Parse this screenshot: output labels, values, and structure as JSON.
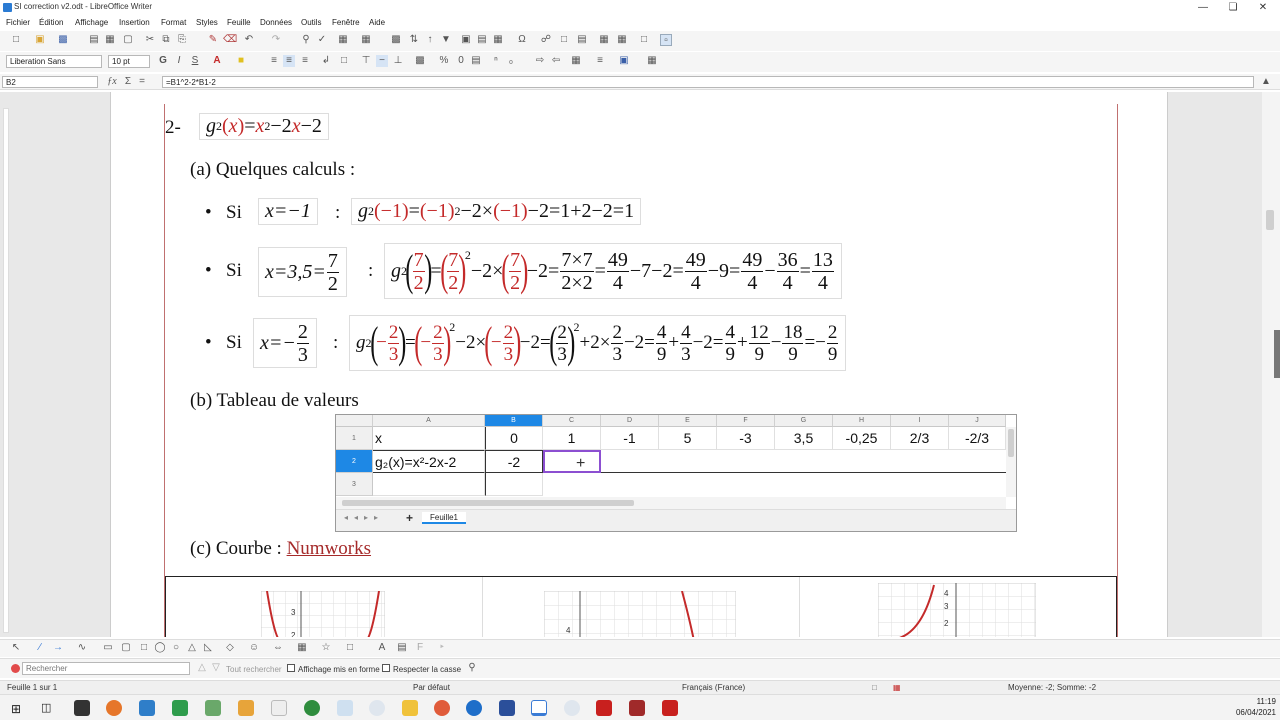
{
  "window": {
    "title": "SI correction v2.odt - LibreOffice Writer"
  },
  "menu": [
    "Fichier",
    "Édition",
    "Affichage",
    "Insertion",
    "Format",
    "Styles",
    "Feuille",
    "Données",
    "Outils",
    "Fenêtre",
    "Aide"
  ],
  "format_bar": {
    "font_name": "Liberation Sans",
    "font_size": "10 pt",
    "bold": "G",
    "italic": "I",
    "underline": "S"
  },
  "formula_bar": {
    "cell_ref": "B2",
    "formula": "=B1^2-2*B1-2"
  },
  "document": {
    "heading_number": "2-",
    "function_def": {
      "name": "g",
      "sub": "2",
      "rhs_a": "=",
      "x": "x",
      "sq": "2",
      "rhs_b": "−2",
      "rhs_c": "−2"
    },
    "section_a": "(a) Quelques calculs :",
    "bullet_si": "Si",
    "colon": ":",
    "calc1": {
      "cond": "x=−1",
      "expr_g": "g",
      "expr_sub": "2",
      "arg": "(−1)",
      "eq": "=",
      "sq_base": "(−1)",
      "sq": "2",
      "rest": "−2×",
      "arg2": "(−1)",
      "tail": "−2=1+2−2=1"
    },
    "calc2": {
      "cond_a": "x=3,5=",
      "cond_num": "7",
      "cond_den": "2",
      "arg_num": "7",
      "arg_den": "2",
      "sq": "2",
      "mid": "−2×",
      "tail1": "−2=",
      "f1_num": "7×7",
      "f1_den": "2×2",
      "eq": "=",
      "f2_num": "49",
      "f2_den": "4",
      "t2": "−7−2=",
      "f3_num": "49",
      "f3_den": "4",
      "t3": "−9=",
      "f4_num": "49",
      "f4_den": "4",
      "minus": "−",
      "f5_num": "36",
      "f5_den": "4",
      "f6_num": "13",
      "f6_den": "4"
    },
    "calc3": {
      "cond_a": "x=−",
      "cond_num": "2",
      "cond_den": "3",
      "neg": "−",
      "arg_num": "2",
      "arg_den": "3",
      "sq": "2",
      "mid": "−2×",
      "t1": "−2=",
      "p_num": "2",
      "p_den": "3",
      "t2": "+2×",
      "f1_num": "2",
      "f1_den": "3",
      "t3": "−2=",
      "f2_num": "4",
      "f2_den": "9",
      "plus": "+",
      "f3_num": "4",
      "f3_den": "3",
      "t4": "−2=",
      "f4_num": "4",
      "f4_den": "9",
      "f5_num": "12",
      "f5_den": "9",
      "minus": "−",
      "f6_num": "18",
      "f6_den": "9",
      "eqneg": "=−",
      "f7_num": "2",
      "f7_den": "9"
    },
    "section_b": "(b) Tableau de valeurs",
    "section_c_prefix": "(c) Courbe : ",
    "section_c_link": "Numworks"
  },
  "sheet": {
    "columns": [
      "A",
      "B",
      "C",
      "D",
      "E",
      "F",
      "G",
      "H",
      "I",
      "J"
    ],
    "rows": [
      "1",
      "2",
      "3"
    ],
    "row1": [
      "x",
      "0",
      "1",
      "-1",
      "5",
      "-3",
      "3,5",
      "-0,25",
      "2/3",
      "-2/3"
    ],
    "row2": [
      "g₂(x)=x²-2x-2",
      "-2",
      "",
      "",
      "",
      "",
      "",
      "",
      "",
      ""
    ],
    "tab_name": "Feuille1",
    "add_tab": "+"
  },
  "graphs": {
    "g1": {
      "t1": "3",
      "t2": "2"
    },
    "g2": {
      "t1": "4"
    },
    "g3": {
      "t1": "4",
      "t2": "3",
      "t3": "2"
    }
  },
  "findbar": {
    "placeholder": "Rechercher",
    "find_all": "Tout rechercher",
    "formatted": "Affichage mis en forme",
    "match_case": "Respecter la casse"
  },
  "status": {
    "page": "Feuille 1 sur 1",
    "style": "Par défaut",
    "language": "Français (France)",
    "stats": "Moyenne: -2; Somme: -2"
  },
  "clock": {
    "time": "11:19",
    "date": "06/04/2021"
  },
  "colors": {
    "accent_red": "#c42a2a",
    "cell_highlight": "#1e88e5",
    "selection": "#8c4fd1"
  }
}
